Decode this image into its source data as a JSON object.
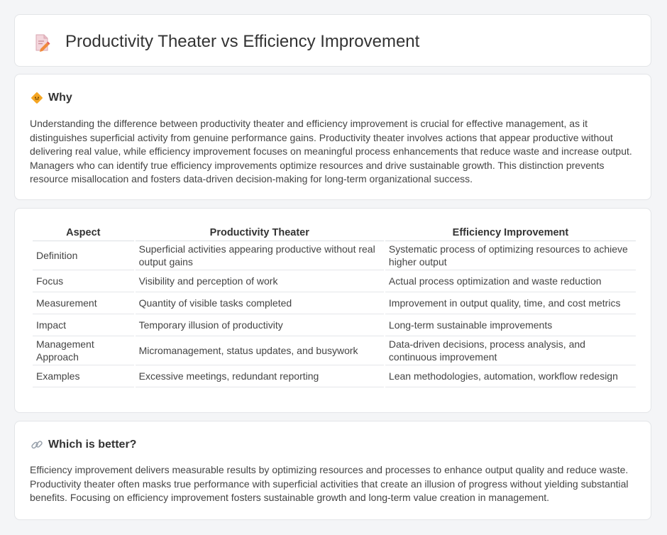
{
  "header": {
    "title": "Productivity Theater vs Efficiency Improvement",
    "icon": "document-pencil-icon"
  },
  "why": {
    "heading": "Why",
    "icon": "diamond-sign-icon",
    "text": "Understanding the difference between productivity theater and efficiency improvement is crucial for effective management, as it distinguishes superficial activity from genuine performance gains. Productivity theater involves actions that appear productive without delivering real value, while efficiency improvement focuses on meaningful process enhancements that reduce waste and increase output. Managers who can identify true efficiency improvements optimize resources and drive sustainable growth. This distinction prevents resource misallocation and fosters data-driven decision-making for long-term organizational success."
  },
  "comparison": {
    "headers": [
      "Aspect",
      "Productivity Theater",
      "Efficiency Improvement"
    ],
    "rows": [
      {
        "aspect": "Definition",
        "theater": "Superficial activities appearing productive without real output gains",
        "efficiency": "Systematic process of optimizing resources to achieve higher output"
      },
      {
        "aspect": "Focus",
        "theater": "Visibility and perception of work",
        "efficiency": "Actual process optimization and waste reduction"
      },
      {
        "aspect": "Measurement",
        "theater": "Quantity of visible tasks completed",
        "efficiency": "Improvement in output quality, time, and cost metrics"
      },
      {
        "aspect": "Impact",
        "theater": "Temporary illusion of productivity",
        "efficiency": "Long-term sustainable improvements"
      },
      {
        "aspect": "Management Approach",
        "theater": "Micromanagement, status updates, and busywork",
        "efficiency": "Data-driven decisions, process analysis, and continuous improvement"
      },
      {
        "aspect": "Examples",
        "theater": "Excessive meetings, redundant reporting",
        "efficiency": "Lean methodologies, automation, workflow redesign"
      }
    ]
  },
  "better": {
    "heading": "Which is better?",
    "icon": "link-icon",
    "text": "Efficiency improvement delivers measurable results by optimizing resources and processes to enhance output quality and reduce waste. Productivity theater often masks true performance with superficial activities that create an illusion of progress without yielding substantial benefits. Focusing on efficiency improvement fosters sustainable growth and long-term value creation in management."
  },
  "colors": {
    "background": "#f4f5f7",
    "card": "#ffffff",
    "accent": "#f0a030"
  }
}
